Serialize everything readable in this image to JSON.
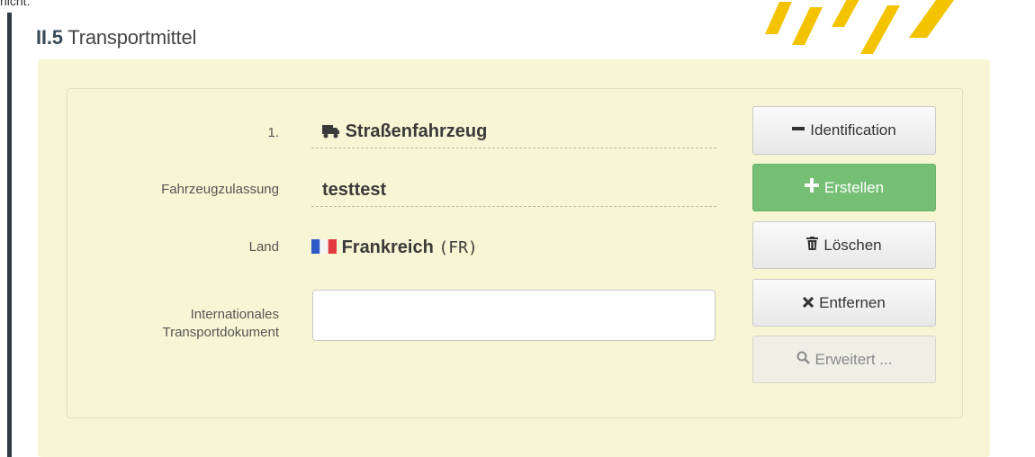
{
  "top_text": "nicht.",
  "section": {
    "number": "II.5",
    "title": "Transportmittel"
  },
  "fields": {
    "index": {
      "label": "1.",
      "value": "Straßenfahrzeug"
    },
    "registration": {
      "label": "Fahrzeugzulassung",
      "value": "testtest"
    },
    "country": {
      "label": "Land",
      "name": "Frankreich",
      "code": "(FR)"
    },
    "document": {
      "label_line1": "Internationales",
      "label_line2": "Transportdokument",
      "value": ""
    }
  },
  "buttons": {
    "identification": "Identification",
    "create": "Erstellen",
    "delete": "Löschen",
    "remove": "Entfernen",
    "advanced": "Erweitert ..."
  },
  "icons": {
    "vehicle": "truck-icon",
    "flag": "flag-fr-icon",
    "minus": "minus-icon",
    "plus": "plus-icon",
    "trash": "trash-icon",
    "times": "times-icon",
    "search": "search-icon"
  },
  "colors": {
    "panel": "#f7f6d4",
    "green_button": "#74bf73",
    "watermark": "#f3c300"
  }
}
